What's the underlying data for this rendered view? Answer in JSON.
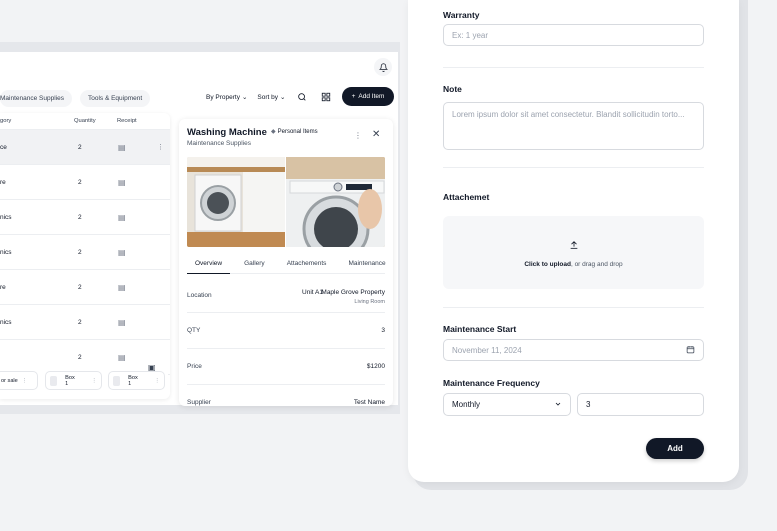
{
  "filters": {
    "chips": [
      "Maintenance Supplies",
      "Tools & Equipment"
    ],
    "by_property": "By Property",
    "sort_by": "Sort by",
    "add_item": "Add Item"
  },
  "table": {
    "headers": [
      "gory",
      "Quantity",
      "Receipt"
    ],
    "rows": [
      {
        "category": "ce",
        "quantity": "2"
      },
      {
        "category": "re",
        "quantity": "2"
      },
      {
        "category": "nics",
        "quantity": "2"
      },
      {
        "category": "nics",
        "quantity": "2"
      },
      {
        "category": "re",
        "quantity": "2"
      },
      {
        "category": "nics",
        "quantity": "2"
      },
      {
        "category": "",
        "quantity": "2"
      }
    ]
  },
  "boxes": [
    "or sale",
    "Box 1",
    "Box 1"
  ],
  "detail": {
    "title": "Washing Machine",
    "tag": "Personal Items",
    "subtitle": "Maintenance Supplies",
    "tabs": [
      "Overview",
      "Gallery",
      "Attachements",
      "Maintenance"
    ],
    "location_label": "Location",
    "location_unit": "Unit A1",
    "location_property": "Maple Grove Property",
    "location_room": "Living Room",
    "qty_label": "QTY",
    "qty_value": "3",
    "price_label": "Price",
    "price_value": "$1200",
    "supplier_label": "Supplier",
    "supplier_value": "Test Name"
  },
  "form": {
    "warranty_label": "Warranty",
    "warranty_placeholder": "Ex: 1 year",
    "note_label": "Note",
    "note_placeholder": "Lorem ipsum dolor sit amet consectetur. Blandit sollicitudin torto...",
    "attachment_label": "Attachemet",
    "upload_link": "Click to upload",
    "upload_rest": ", or drag and drop",
    "maintenance_start_label": "Maintenance Start",
    "maintenance_start_value": "November 11, 2024",
    "frequency_label": "Maintenance Frequency",
    "frequency_value": "Monthly",
    "frequency_count": "3",
    "add_label": "Add"
  }
}
